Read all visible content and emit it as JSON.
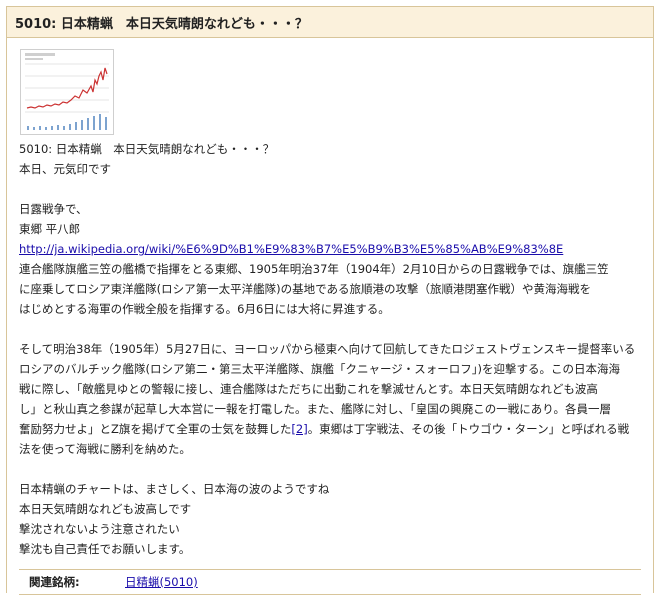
{
  "post": {
    "title": "5010: 日本精蝋　本日天気晴朗なれども・・・？",
    "intro_line1": "5010: 日本精蝋　本日天気晴朗なれども・・・？",
    "intro_line2": "本日、元気印です",
    "war_heading": "日露戦争で、",
    "person": "東郷 平八郎",
    "wiki_url": "http://ja.wikipedia.org/wiki/%E6%9D%B1%E9%83%B7%E5%B9%B3%E5%85%AB%E9%83%8E",
    "para1_line1": "連合艦隊旗艦三笠の艦橋で指揮をとる東郷、1905年明治37年（1904年）2月10日からの日露戦争では、旗艦三笠",
    "para1_line2": "に座乗してロシア東洋艦隊(ロシア第一太平洋艦隊)の基地である旅順港の攻撃（旅順港閉塞作戦）や黄海海戦を",
    "para1_line3": "はじめとする海軍の作戦全般を指揮する。6月6日には大将に昇進する。",
    "para2_line1": "そして明治38年（1905年）5月27日に、ヨーロッパから極東へ向けて回航してきたロジェストヴェンスキー提督率いる",
    "para2_line2": "ロシアのバルチック艦隊(ロシア第二・第三太平洋艦隊、旗艦「クニャージ・スォーロフ」)を迎撃する。この日本海海",
    "para2_line3": "戦に際し、「敵艦見ゆとの警報に接し、連合艦隊はただちに出動これを撃滅せんとす。本日天気晴朗なれども波高",
    "para2_line4": "し」と秋山真之参謀が起草し大本営に一報を打電した。また、艦隊に対し、「皇国の興廃この一戦にあり。各員一層",
    "para2_line5a": "奮励努力せよ」とZ旗を掲げて全軍の士気を鼓舞した",
    "para2_ref": "[2]",
    "para2_line5b": "。東郷は丁字戦法、その後「トウゴウ・ターン」と呼ばれる戦",
    "para2_line6": "法を使って海戦に勝利を納めた。",
    "closing_line1": "日本精蝋のチャートは、まさしく、日本海の波のようですね",
    "closing_line2": "本日天気晴朗なれども波高しです",
    "closing_line3": "撃沈されないよう注意されたい",
    "closing_line4": "撃沈も自己責任でお願いします。"
  },
  "related": {
    "label": "関連銘柄:",
    "stock_link": "日精蝋(5010)"
  },
  "thumbnail": {
    "icon": "stock-chart-thumbnail",
    "line_color": "#cc3333",
    "volume_color": "#7da3cf"
  }
}
